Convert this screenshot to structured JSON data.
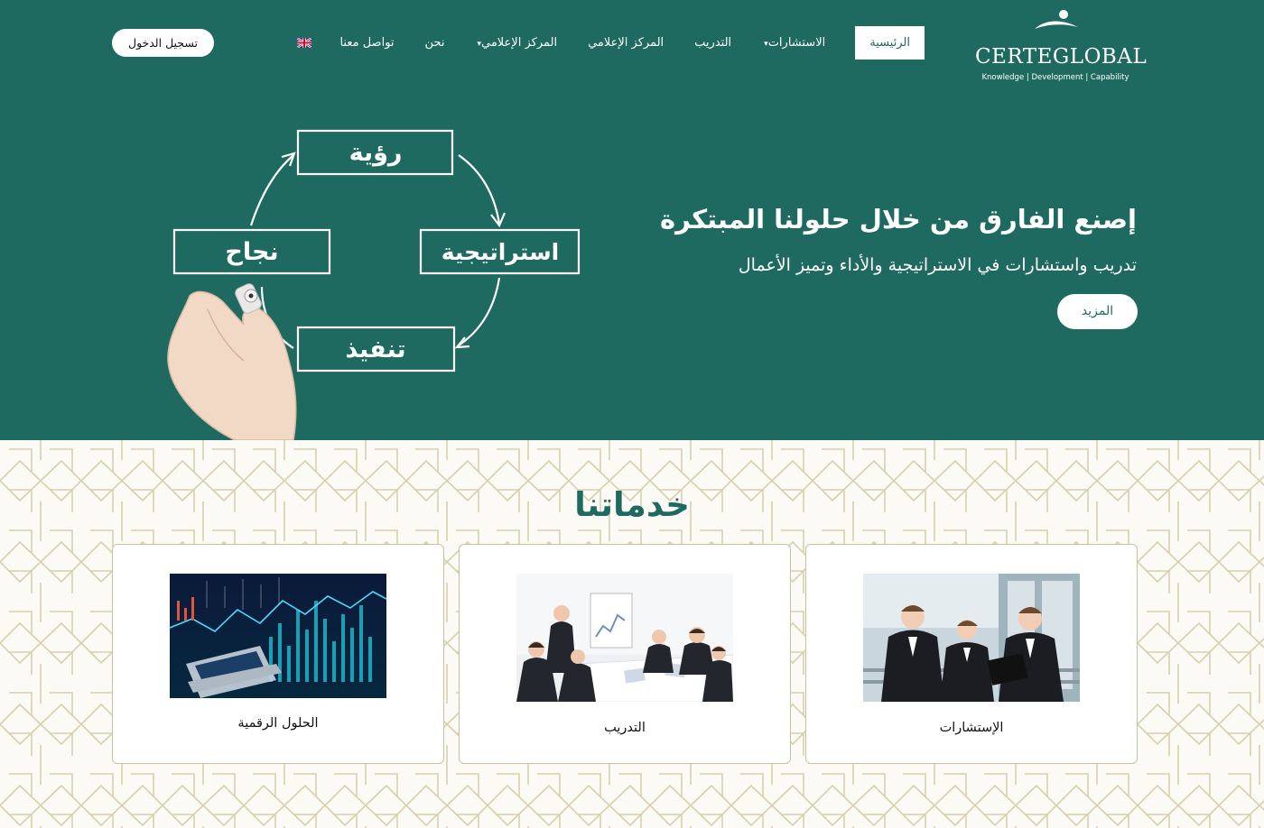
{
  "brand": {
    "name": "CERTEGLOBAL",
    "tagline": "Knowledge | Development | Capability"
  },
  "nav": {
    "items": [
      {
        "label": "الرئيسية",
        "active": true
      },
      {
        "label": "الاستشارات",
        "caret": "▾"
      },
      {
        "label": "التدريب"
      },
      {
        "label": "المركز الإعلامي"
      },
      {
        "label": "المركز الإعلامي",
        "caret": "▾"
      },
      {
        "label": "نحن"
      },
      {
        "label": "تواصل معنا"
      }
    ],
    "language_flag": "uk-flag-icon",
    "login_label": "تسجيل الدخول"
  },
  "hero": {
    "title": "إصنع الفارق من خلال حلولنا المبتكرة",
    "subtitle": "تدريب واستشارات في الاستراتيجية والأداء وتميز الأعمال",
    "cta_label": "المزيد",
    "cycle": [
      "رؤية",
      "استراتيجية",
      "تنفيذ",
      "نجاح"
    ]
  },
  "services": {
    "title": "خدماتنا",
    "cards": [
      {
        "label": "الإستشارات",
        "image": "business-team-photo"
      },
      {
        "label": "التدريب",
        "image": "training-meeting-photo"
      },
      {
        "label": "الحلول الرقمية",
        "image": "digital-chart-photo"
      }
    ]
  },
  "colors": {
    "primary": "#1e6a60",
    "card_border": "#cdbf9b",
    "pattern": "#d8cfae"
  }
}
